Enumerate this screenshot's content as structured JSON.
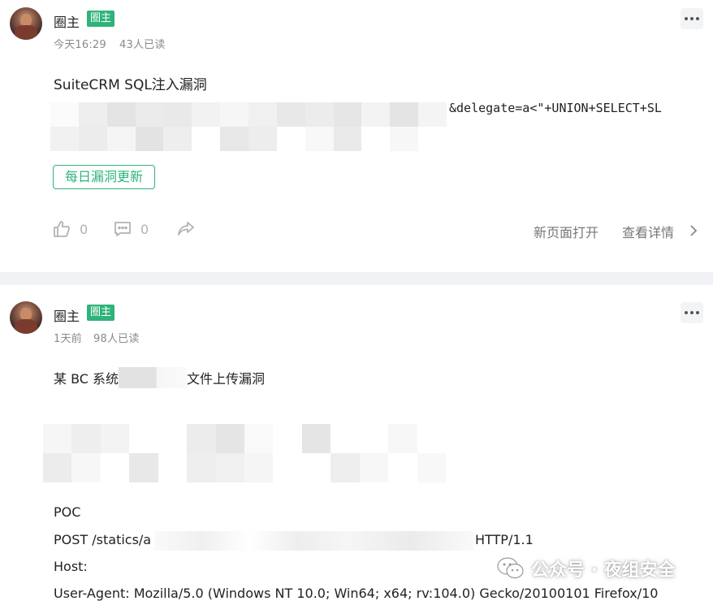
{
  "posts": [
    {
      "author": "圈主",
      "badge": "圈主",
      "time": "今天16:29",
      "reads": "43人已读",
      "title": "SuiteCRM SQL注入漏洞",
      "code_tail": "&delegate=a<\"+UNION+SELECT+SL",
      "tag": "每日漏洞更新",
      "likes": "0",
      "comments": "0",
      "open_new": "新页面打开",
      "details": "查看详情"
    },
    {
      "author": "圈主",
      "badge": "圈主",
      "time": "1天前",
      "reads": "98人已读",
      "title_prefix": "某 BC 系统",
      "title_suffix": "文件上传漏洞",
      "poc_label": "POC",
      "post_line_prefix": "POST /statics/a",
      "post_line_suffix": "HTTP/1.1",
      "host_line": "Host:",
      "ua_line": "User-Agent: Mozilla/5.0 (Windows NT 10.0; Win64; x64; rv:104.0) Gecko/20100101 Firefox/10"
    }
  ],
  "watermark": {
    "text": "公众号 · 夜组安全"
  },
  "icons": {
    "more": "more-dots-icon",
    "like": "thumbs-up-icon",
    "comment": "comment-icon",
    "share": "share-icon",
    "chevron": "chevron-right-icon",
    "wechat": "wechat-icon"
  },
  "colors": {
    "accent": "#2fb37a",
    "muted": "#8a8a8a",
    "divider": "#f1f2f5"
  }
}
